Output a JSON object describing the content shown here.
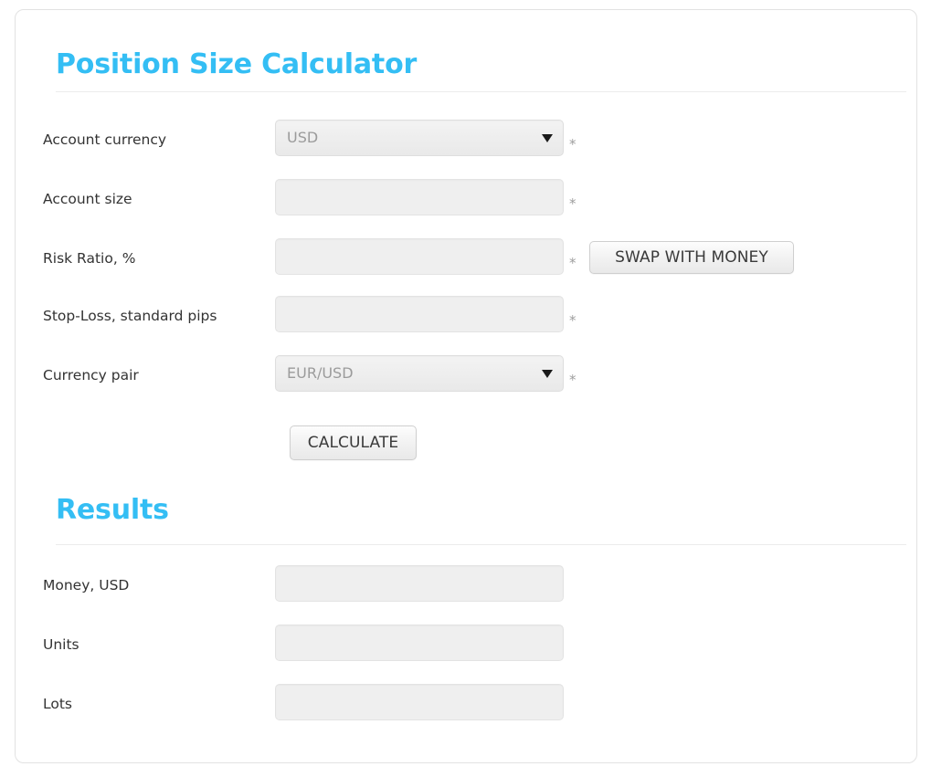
{
  "panel": {
    "calculator": {
      "title": "Position Size Calculator",
      "fields": [
        {
          "label": "Account currency",
          "type": "select",
          "value": "USD",
          "required_marker": "*",
          "name": "account-currency"
        },
        {
          "label": "Account size",
          "type": "text",
          "value": "",
          "placeholder": "",
          "required_marker": "*",
          "name": "account-size"
        },
        {
          "label": "Risk Ratio, %",
          "type": "text",
          "value": "",
          "placeholder": "",
          "required_marker": "*",
          "name": "risk-ratio"
        },
        {
          "label": "Stop-Loss, standard pips",
          "type": "text",
          "value": "",
          "placeholder": "",
          "required_marker": "*",
          "name": "stop-loss"
        },
        {
          "label": "Currency pair",
          "type": "select",
          "value": "EUR/USD",
          "required_marker": "*",
          "name": "currency-pair"
        }
      ],
      "swap_button_label": "SWAP WITH MONEY",
      "calculate_button_label": "CALCULATE"
    },
    "results": {
      "title": "Results",
      "fields": [
        {
          "label": "Money, USD",
          "value": "",
          "name": "money-usd"
        },
        {
          "label": "Units",
          "value": "",
          "name": "units"
        },
        {
          "label": "Lots",
          "value": "",
          "name": "lots"
        }
      ]
    }
  },
  "colors": {
    "heading": "#34bef4",
    "label": "#333333",
    "field_background": "#efefef",
    "field_border": "#e3e3e3",
    "divider": "#ececec",
    "panel_border": "#e2e2e2",
    "select_value_text": "#9b9b9b",
    "asterisk": "#9e9e9e"
  },
  "icons": {
    "select_caret": "chevron-down-icon"
  }
}
